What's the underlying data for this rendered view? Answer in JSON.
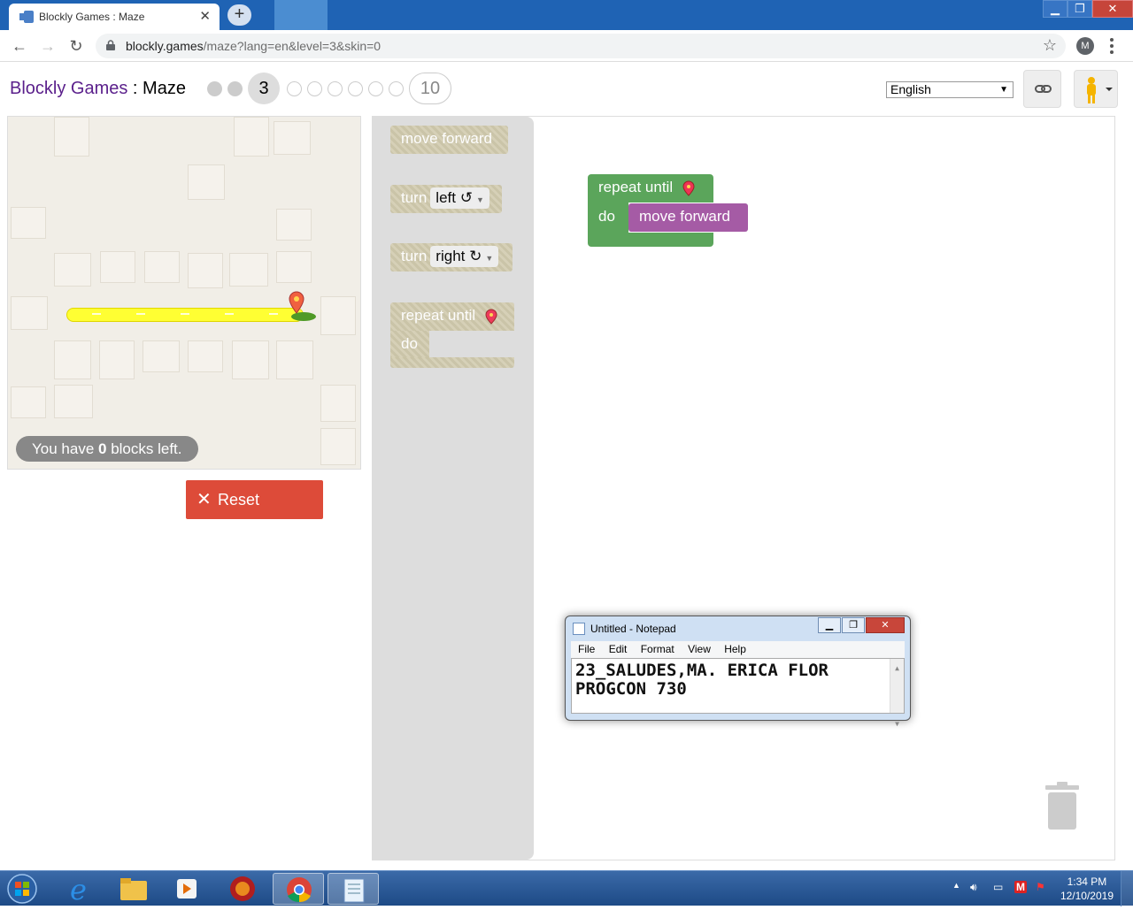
{
  "browser": {
    "tab_title": "Blockly Games : Maze",
    "tab_close": "✕",
    "new_tab": "+",
    "url_host": "blockly.games",
    "url_path": "/maze?lang=en&level=3&skin=0",
    "profile_initial": "M"
  },
  "header": {
    "brand": "Blockly Games",
    "separator": " : ",
    "game": "Maze",
    "current_level": "3",
    "last_level": "10",
    "language": "English"
  },
  "maze": {
    "capacity_prefix": "You have ",
    "capacity_count": "0",
    "capacity_suffix": " blocks left.",
    "path_color": "#ffff33"
  },
  "controls": {
    "reset_label": "Reset",
    "reset_color": "#dd4b39"
  },
  "toolbox": {
    "move_forward": "move forward",
    "turn_left_prefix": "turn",
    "turn_left_value": "left ↺",
    "turn_right_prefix": "turn",
    "turn_right_value": "right ↻",
    "repeat_until": "repeat until",
    "do": "do"
  },
  "workspace": {
    "repeat_until": "repeat until",
    "do": "do",
    "move_forward": "move forward",
    "loop_color": "#5ba55b",
    "move_color": "#a55ba5"
  },
  "notepad": {
    "title": "Untitled - Notepad",
    "menu": [
      "File",
      "Edit",
      "Format",
      "View",
      "Help"
    ],
    "line1": "23_SALUDES,MA. ERICA FLOR",
    "line2": "PROGCON 730"
  },
  "taskbar": {
    "time": "1:34 PM",
    "date": "12/10/2019"
  }
}
